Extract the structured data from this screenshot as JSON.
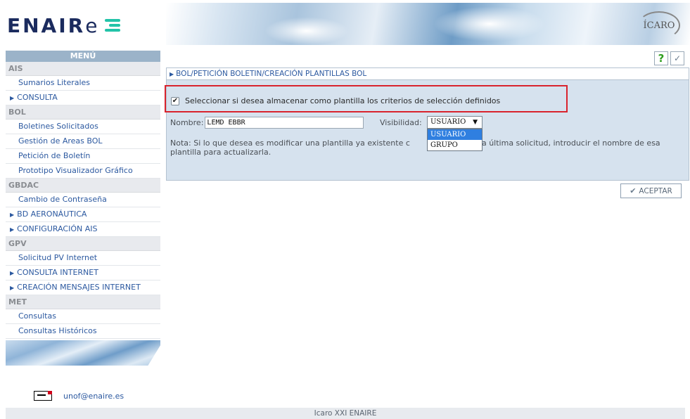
{
  "header": {
    "logo_main": "ENAIR",
    "logo_e": "e",
    "icaro_label": "ÍCARO"
  },
  "sidebar": {
    "title": "MENÚ",
    "sections": [
      {
        "title": "AIS",
        "items": [
          {
            "label": "Sumarios Literales",
            "expandable": false
          },
          {
            "label": "CONSULTA",
            "expandable": true
          }
        ]
      },
      {
        "title": "BOL",
        "items": [
          {
            "label": "Boletines Solicitados",
            "expandable": false
          },
          {
            "label": "Gestión de Areas BOL",
            "expandable": false
          },
          {
            "label": "Petición de Boletín",
            "expandable": false
          },
          {
            "label": "Prototipo Visualizador Gráfico",
            "expandable": false
          }
        ]
      },
      {
        "title": "GBDAC",
        "items": [
          {
            "label": "Cambio de Contraseña",
            "expandable": false
          },
          {
            "label": "BD AERONÁUTICA",
            "expandable": true
          },
          {
            "label": "CONFIGURACIÓN AIS",
            "expandable": true
          }
        ]
      },
      {
        "title": "GPV",
        "items": [
          {
            "label": "Solicitud PV Internet",
            "expandable": false
          },
          {
            "label": "CONSULTA INTERNET",
            "expandable": true
          },
          {
            "label": "CREACIÓN MENSAJES INTERNET",
            "expandable": true
          }
        ]
      },
      {
        "title": "MET",
        "items": [
          {
            "label": "Consultas",
            "expandable": false
          },
          {
            "label": "Consultas Históricos",
            "expandable": false
          }
        ]
      }
    ]
  },
  "contact": {
    "email": "unof@enaire.es"
  },
  "toolbar": {
    "help_glyph": "?",
    "check_glyph": "✓"
  },
  "panel": {
    "breadcrumb": "BOL/PETICIÓN BOLETIN/CREACIÓN PLANTILLAS BOL",
    "checkbox_label": "Seleccionar si desea almacenar como plantilla los criterios de selección definidos",
    "checkbox_checked": true,
    "name_label": "Nombre:",
    "name_value": "LEMD EBBR",
    "visibility_label": "Visibilidad:",
    "visibility_value": "USUARIO",
    "visibility_options": [
      "USUARIO",
      "GRUPO"
    ],
    "note": "Nota: Si lo que desea es modificar una plantilla ya existente c",
    "note_rest": "de esta última solicitud, introducir el nombre de esa plantilla para actualizarla."
  },
  "actions": {
    "accept_label": "ACEPTAR"
  },
  "footer": {
    "text": "Icaro XXI ENAIRE"
  },
  "colors": {
    "highlight": "#d9232d",
    "link": "#2c59a0",
    "panel_bg": "#d6e2ee",
    "logo_accent": "#22c3a8"
  }
}
